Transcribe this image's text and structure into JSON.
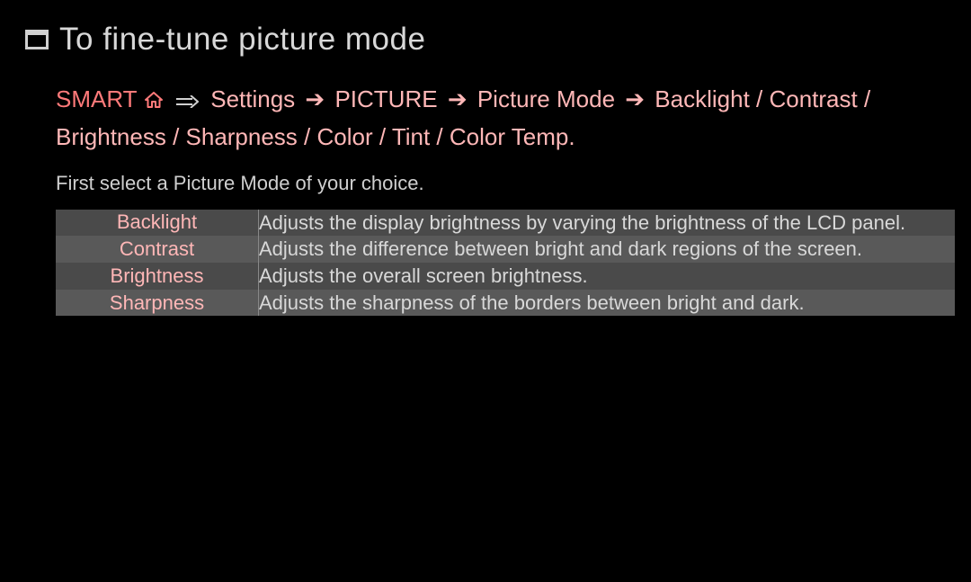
{
  "title": "To fine-tune picture mode",
  "path": {
    "smart": "SMART",
    "settings": "Settings",
    "picture": "PICTURE",
    "pictureMode": "Picture Mode",
    "options": "Backlight / Contrast / Brightness / Sharpness / Color / Tint / Color Temp."
  },
  "intro": "First select a Picture Mode of your choice.",
  "rows": [
    {
      "label": "Backlight",
      "desc": "Adjusts the display brightness by varying the brightness of the LCD panel."
    },
    {
      "label": "Contrast",
      "desc": "Adjusts the difference between bright and dark regions of the screen."
    },
    {
      "label": "Brightness",
      "desc": "Adjusts the overall screen brightness."
    },
    {
      "label": "Sharpness",
      "desc": "Adjusts the sharpness of the borders between bright and dark."
    }
  ]
}
